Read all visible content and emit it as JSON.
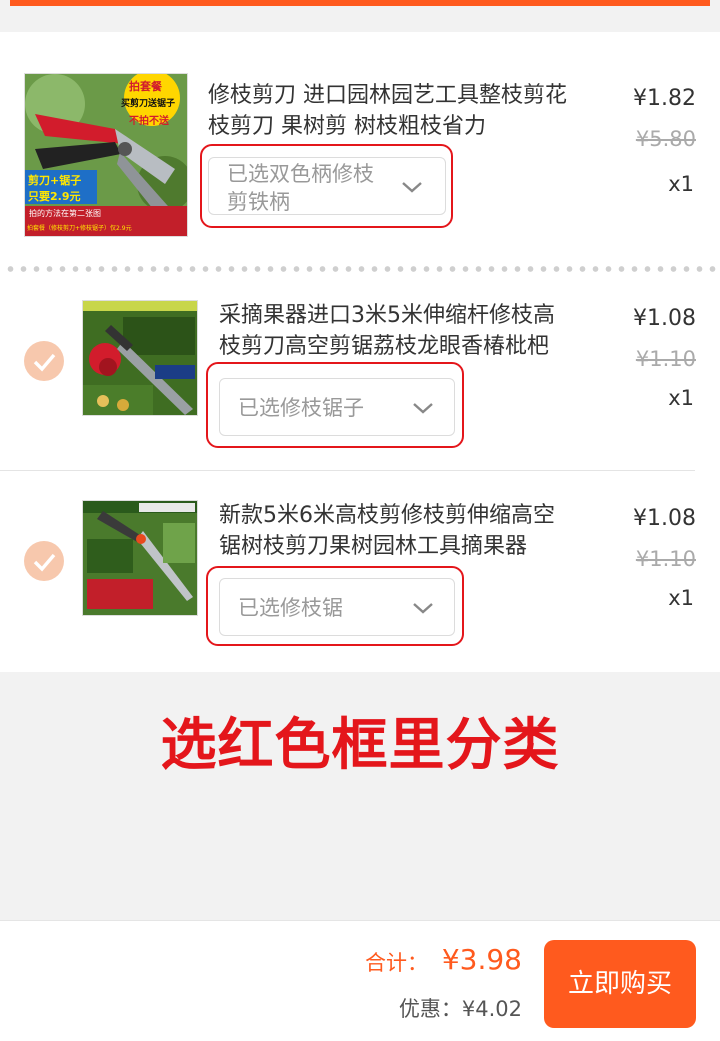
{
  "items": [
    {
      "title_line1": "修枝剪刀 进口园林园艺工具整枝剪花",
      "title_line2": "枝剪刀 果树剪 树枝粗枝省力",
      "sku_line1": "已选双色柄修枝",
      "sku_line2": "剪铁柄",
      "price": "¥1.82",
      "original_price": "¥5.80",
      "qty": "x1",
      "thumb": {
        "badge_top": "拍套餐",
        "badge_mid": "买剪刀送锯子",
        "badge_bot": "不拍不送",
        "promo_l1": "剪刀+锯子",
        "promo_l2": "只要2.9元",
        "footer_l1": "拍的方法在第二张图",
        "footer_l2": "拍套餐（修枝剪刀+修枝锯子）仅2.9元"
      },
      "selected": false
    },
    {
      "title_line1": "采摘果器进口3米5米伸缩杆修枝高",
      "title_line2": "枝剪刀高空剪锯荔枝龙眼香椿枇杷",
      "sku_line1": "已选修枝锯子",
      "price": "¥1.08",
      "original_price": "¥1.10",
      "qty": "x1",
      "selected": true
    },
    {
      "title_line1": "新款5米6米高枝剪修枝剪伸缩高空",
      "title_line2": "锯树枝剪刀果树园林工具摘果器",
      "sku_line1": "已选修枝锯",
      "price": "¥1.08",
      "original_price": "¥1.10",
      "qty": "x1",
      "selected": true
    }
  ],
  "notice": "选红色框里分类",
  "footer": {
    "total_label": "合计：",
    "total_value": "¥3.98",
    "saving": "优惠：¥4.02",
    "buy_button": "立即购买"
  },
  "colors": {
    "accent": "#ff5a1e",
    "annotation_red": "#e4161b",
    "check_fill": "#f7c8ad"
  }
}
